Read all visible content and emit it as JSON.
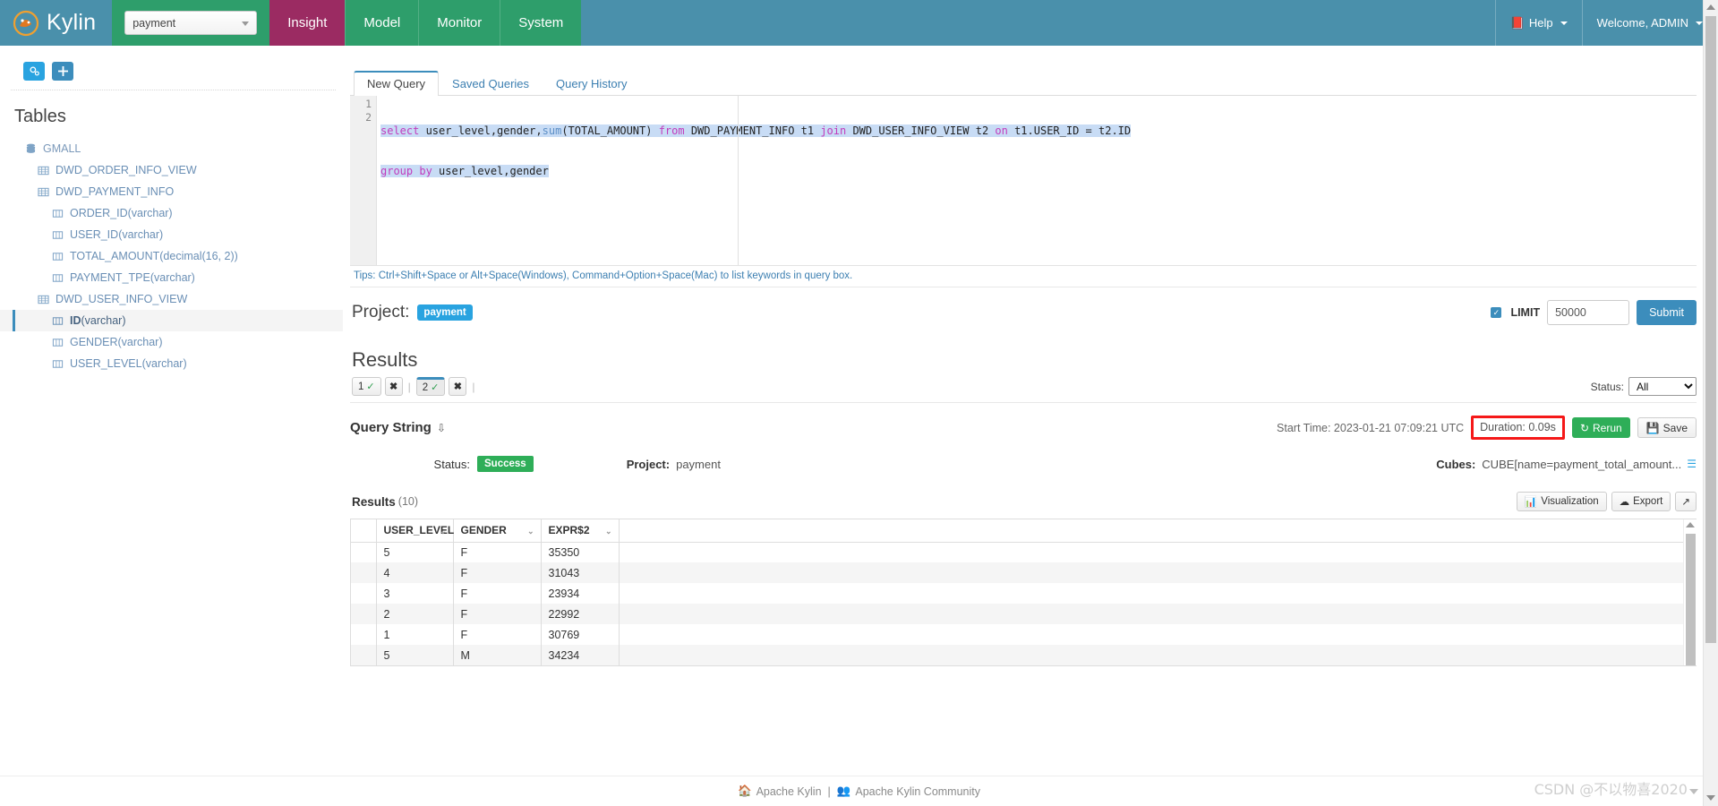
{
  "navbar": {
    "brand": "Kylin",
    "project_select_value": "payment",
    "menu": [
      {
        "label": "Insight",
        "active": true
      },
      {
        "label": "Model",
        "active": false
      },
      {
        "label": "Monitor",
        "active": false
      },
      {
        "label": "System",
        "active": false
      }
    ],
    "help_label": "Help",
    "user_label": "Welcome, ADMIN"
  },
  "sidebar": {
    "title": "Tables",
    "tools": {
      "config_icon": "gears-icon",
      "add_icon": "plus-icon"
    },
    "tree": [
      {
        "label": "GMALL",
        "type": "",
        "level": 0,
        "icon": "database-icon",
        "selected": false
      },
      {
        "label": "DWD_ORDER_INFO_VIEW",
        "type": "",
        "level": 1,
        "icon": "table-icon",
        "selected": false
      },
      {
        "label": "DWD_PAYMENT_INFO",
        "type": "",
        "level": 1,
        "icon": "table-icon",
        "selected": false
      },
      {
        "label": "ORDER_ID",
        "type": "(varchar)",
        "level": 2,
        "icon": "column-icon",
        "selected": false
      },
      {
        "label": "USER_ID",
        "type": "(varchar)",
        "level": 2,
        "icon": "column-icon",
        "selected": false
      },
      {
        "label": "TOTAL_AMOUNT",
        "type": "(decimal(16, 2))",
        "level": 2,
        "icon": "column-icon",
        "selected": false
      },
      {
        "label": "PAYMENT_TPE",
        "type": "(varchar)",
        "level": 2,
        "icon": "column-icon",
        "selected": false
      },
      {
        "label": "DWD_USER_INFO_VIEW",
        "type": "",
        "level": 1,
        "icon": "table-icon",
        "selected": false
      },
      {
        "label": "ID",
        "type": "(varchar)",
        "level": 2,
        "icon": "column-icon",
        "selected": true
      },
      {
        "label": "GENDER",
        "type": "(varchar)",
        "level": 2,
        "icon": "column-icon",
        "selected": false
      },
      {
        "label": "USER_LEVEL",
        "type": "(varchar)",
        "level": 2,
        "icon": "column-icon",
        "selected": false
      }
    ]
  },
  "query_tabs": [
    {
      "label": "New Query",
      "active": true
    },
    {
      "label": "Saved Queries",
      "active": false
    },
    {
      "label": "Query History",
      "active": false
    }
  ],
  "editor": {
    "line_numbers": [
      "1",
      "2"
    ],
    "sql_line1_tokens": [
      {
        "t": "select",
        "c": "kw"
      },
      {
        "t": " user_level,gender,",
        "c": "id"
      },
      {
        "t": "sum",
        "c": "fn"
      },
      {
        "t": "(TOTAL_AMOUNT) ",
        "c": "id"
      },
      {
        "t": "from",
        "c": "kw"
      },
      {
        "t": " DWD_PAYMENT_INFO t1 ",
        "c": "id"
      },
      {
        "t": "join",
        "c": "kw"
      },
      {
        "t": " DWD_USER_INFO_VIEW t2 ",
        "c": "id"
      },
      {
        "t": "on",
        "c": "kw"
      },
      {
        "t": " t1.USER_ID = t2.ID",
        "c": "id"
      }
    ],
    "sql_line2_tokens": [
      {
        "t": "group by",
        "c": "kw"
      },
      {
        "t": " user_level,gender",
        "c": "id"
      }
    ],
    "sql_full": "select user_level,gender,sum(TOTAL_AMOUNT) from DWD_PAYMENT_INFO t1 join DWD_USER_INFO_VIEW t2 on t1.USER_ID = t2.ID\ngroup by user_level,gender",
    "tips": "Tips: Ctrl+Shift+Space or Alt+Space(Windows), Command+Option+Space(Mac) to list keywords in query box."
  },
  "submit_bar": {
    "project_label": "Project:",
    "project_badge": "payment",
    "limit_checked": true,
    "limit_label": "LIMIT",
    "limit_value": "50000",
    "submit_label": "Submit"
  },
  "results": {
    "heading": "Results",
    "tabs": [
      {
        "label": "1",
        "status_icon": "check-icon",
        "active": false
      },
      {
        "label": "2",
        "status_icon": "check-icon",
        "active": true
      }
    ],
    "close_label": "✖",
    "status_filter_label": "Status:",
    "status_filter_value": "All",
    "status_filter_options": [
      "All"
    ],
    "query_string_label": "Query String",
    "start_time": "Start Time: 2023-01-21 07:09:21 UTC",
    "duration": "Duration: 0.09s",
    "duration_highlight_color": "#f51818",
    "rerun_label": "Rerun",
    "save_label": "Save",
    "meta": {
      "status_key": "Status:",
      "status_value": "Success",
      "project_key": "Project:",
      "project_value": "payment",
      "cubes_key": "Cubes:",
      "cubes_value": "CUBE[name=payment_total_amount..."
    },
    "table_header_label": "Results",
    "table_count": "(10)",
    "visualization_label": "Visualization",
    "export_label": "Export",
    "expand_icon": "expand-icon"
  },
  "table_data": {
    "columns": [
      "USER_LEVEL",
      "GENDER",
      "EXPR$2"
    ],
    "rows": [
      [
        "5",
        "F",
        "35350"
      ],
      [
        "4",
        "F",
        "31043"
      ],
      [
        "3",
        "F",
        "23934"
      ],
      [
        "2",
        "F",
        "22992"
      ],
      [
        "1",
        "F",
        "30769"
      ],
      [
        "5",
        "M",
        "34234"
      ]
    ]
  },
  "footer": {
    "link1": "Apache Kylin",
    "separator": "|",
    "link2": "Apache Kylin Community",
    "watermark": "CSDN @不以物喜2020"
  }
}
